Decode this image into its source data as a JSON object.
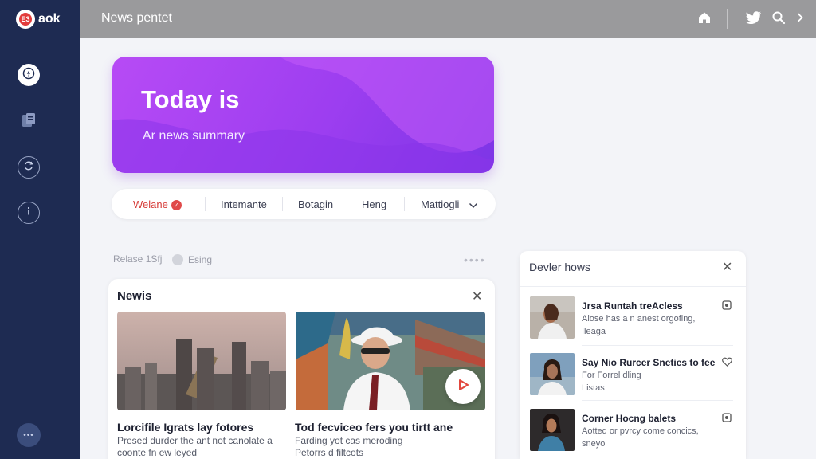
{
  "brand": {
    "logo_text": "E3",
    "name": "aok"
  },
  "header": {
    "title": "News pentet"
  },
  "hero": {
    "title": "Today is",
    "subtitle": "Ar news summary"
  },
  "tabs": [
    {
      "label": "Welane",
      "active": true
    },
    {
      "label": "Intemante",
      "active": false
    },
    {
      "label": "Botagin",
      "active": false
    },
    {
      "label": "Heng",
      "active": false
    },
    {
      "label": "Mattiogli",
      "active": false,
      "has_dropdown": true
    }
  ],
  "meta": {
    "left": "Relase 1Sfj",
    "right": "Esing"
  },
  "news": {
    "title": "Newis",
    "articles": [
      {
        "title": "Lorcifile Igrats lay fotores",
        "lines": [
          "Presed durder the ant not canolate a",
          "coonte fn ew leyed"
        ]
      },
      {
        "title": "Tod fecviceo fers you tirtt ane",
        "lines": [
          "Farding yot cas meroding",
          "Petorrs d filtcots"
        ]
      }
    ]
  },
  "panel": {
    "title": "Devler hows",
    "items": [
      {
        "title": "Jrsa Runtah treAcless",
        "lines": [
          "Alose has a n anest orgofing,",
          "Ileaga"
        ],
        "icon": "bookmark-icon"
      },
      {
        "title": "Say Nio Rurcer Sneties to fee",
        "lines": [
          "For Forrel dling",
          "Listas"
        ],
        "icon": "heart-icon"
      },
      {
        "title": "Corner Hocng balets",
        "lines": [
          "Aotted or pvrcy come concics,",
          "sneyo"
        ],
        "icon": "bookmark-icon"
      }
    ]
  },
  "colors": {
    "sidebar": "#1e2b52",
    "topbar": "#9a9a9c",
    "hero_start": "#b74bf5",
    "hero_end": "#7d35e6",
    "accent_red": "#d63d39"
  }
}
